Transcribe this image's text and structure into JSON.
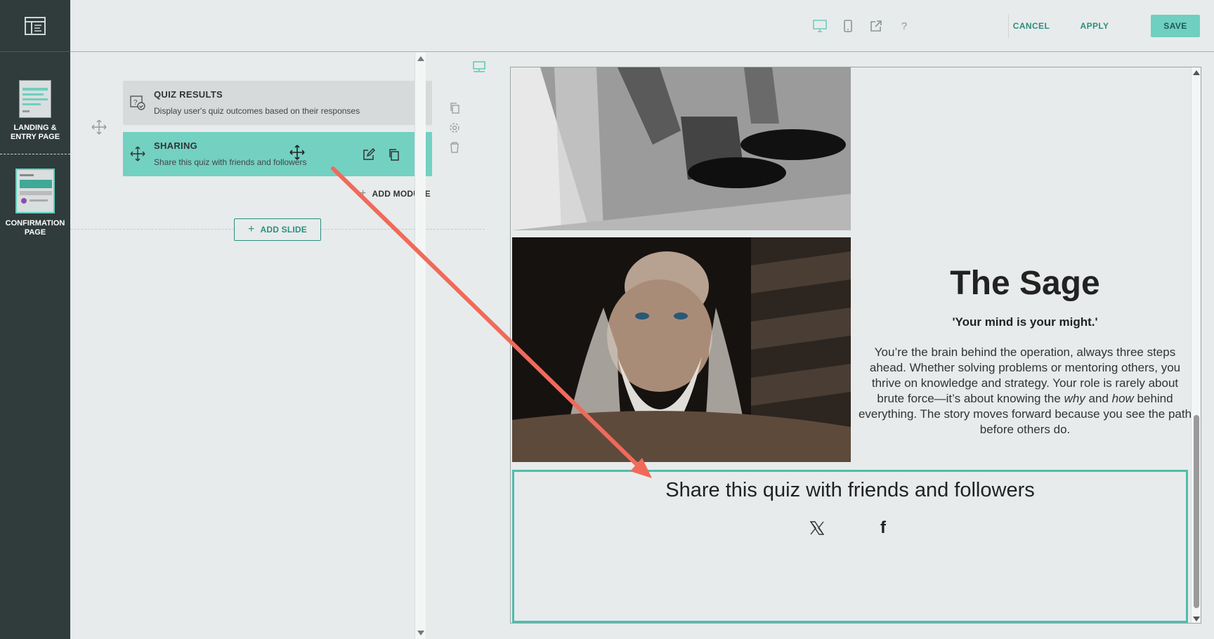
{
  "rail": {
    "pages": [
      {
        "label_line1": "LANDING &",
        "label_line2": "ENTRY PAGE"
      },
      {
        "label_line1": "CONFIRMATION",
        "label_line2": "PAGE"
      }
    ]
  },
  "toolbar": {
    "icons": [
      "desktop-icon",
      "mobile-icon",
      "external-link-icon",
      "help-icon"
    ],
    "help_glyph": "?",
    "cancel_label": "CANCEL",
    "apply_label": "APPLY",
    "save_label": "SAVE"
  },
  "editor": {
    "modules": [
      {
        "title": "QUIZ RESULTS",
        "description": "Display user's quiz outcomes based on their responses"
      },
      {
        "title": "SHARING",
        "description": "Share this quiz with friends and followers"
      }
    ],
    "add_module_label": "ADD MODULE",
    "add_slide_label": "ADD SLIDE"
  },
  "preview": {
    "result_title": "The Sage",
    "result_quote": "'Your mind is your might.'",
    "result_body_1": "You’re the brain behind the operation, always three steps ahead. Whether solving problems or mentoring others, you thrive on knowledge and strategy. Your role is rarely about brute force—it’s about knowing the ",
    "result_body_why": "why",
    "result_body_and": " and ",
    "result_body_how": "how",
    "result_body_2": " behind everything. The story moves forward because you see the path before others do.",
    "share_text": "Share this quiz with friends and followers",
    "share_icons": [
      "x-twitter-icon",
      "facebook-icon"
    ],
    "x_glyph": "𝕏",
    "facebook_glyph": "f"
  },
  "colors": {
    "accent": "#73d1c2",
    "accent_dark": "#2a8f80",
    "rail": "#303b3b",
    "annotation_arrow": "#f06a5a"
  }
}
